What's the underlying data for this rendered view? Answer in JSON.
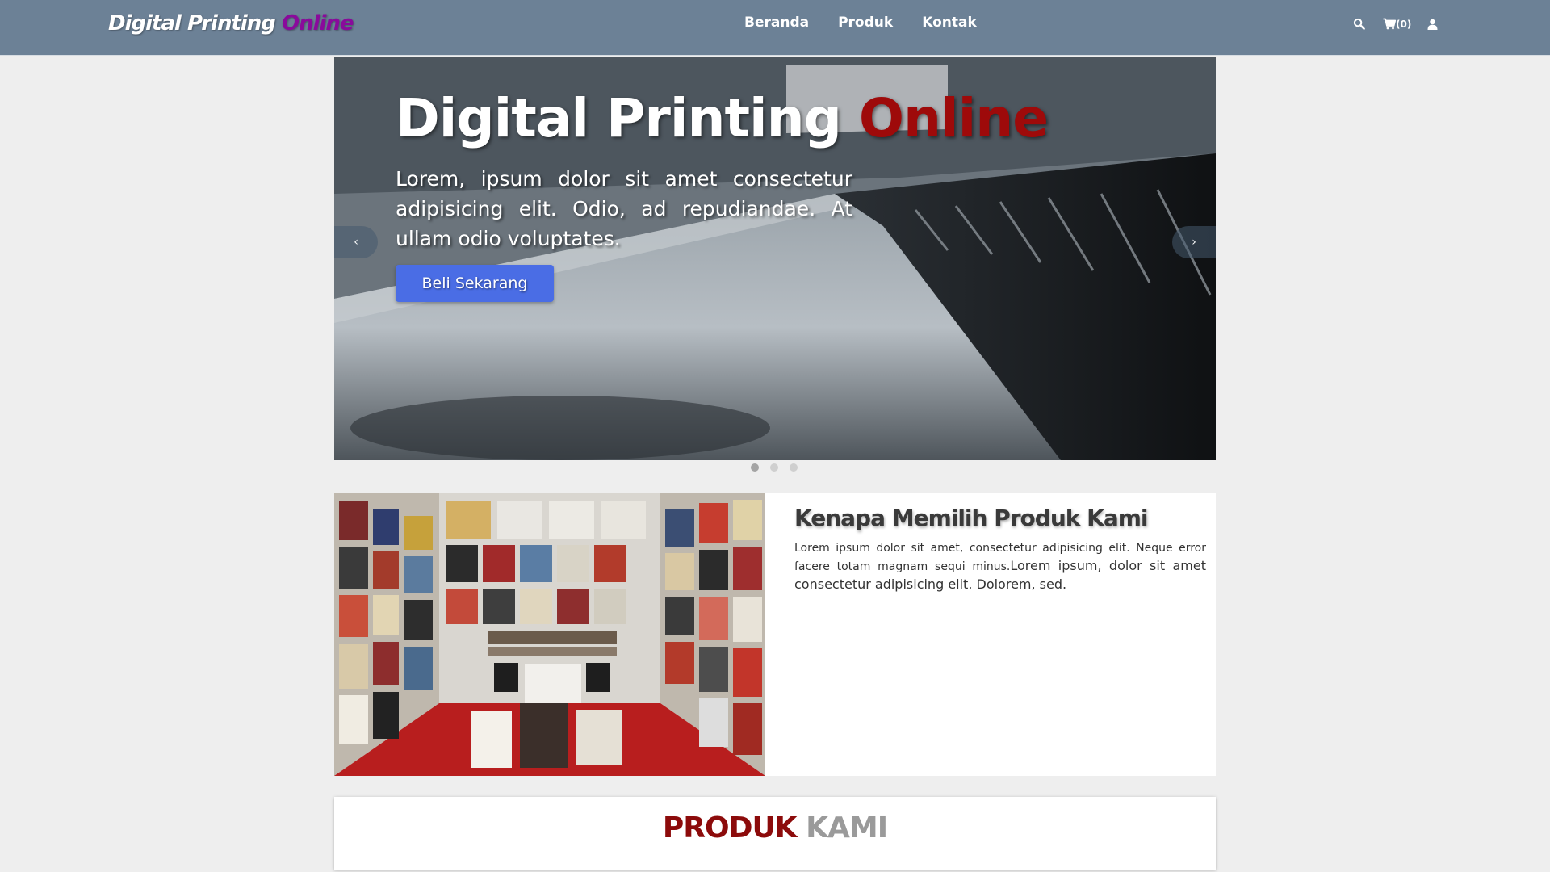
{
  "navbar": {
    "brand_main": "Digital Printing ",
    "brand_accent": "Online",
    "links": [
      "Beranda",
      "Produk",
      "Kontak"
    ],
    "cart_count": "(0)",
    "icons": [
      "search-icon",
      "cart-icon",
      "user-icon"
    ]
  },
  "hero": {
    "title_main": "Digital Printing ",
    "title_accent": "Online",
    "text": "Lorem, ipsum dolor sit amet consectetur adipisicing elit. Odio, ad repudiandae. At ullam odio voluptates.",
    "button_label": "Beli Sekarang",
    "prev_label": "‹",
    "next_label": "›",
    "slide_count": 3,
    "active_slide": 1
  },
  "why": {
    "title": "Kenapa Memilih Produk Kami",
    "body_small": "Lorem ipsum dolor sit amet, consectetur adipisicing elit. Neque error facere totam magnam sequi minus.",
    "body_large": "Lorem ipsum, dolor sit amet consectetur adipisicing elit. Dolorem, sed."
  },
  "products": {
    "title_part1": "PRODUK",
    "title_part2": "KAMI"
  },
  "colors": {
    "navbar_bg": "#6c8196",
    "brand_accent": "#8a0a9c",
    "hero_accent": "#9e0a0a",
    "button_bg": "#4a6de5",
    "products_red": "#8c0b0b",
    "products_gray": "#9a9a9a"
  }
}
